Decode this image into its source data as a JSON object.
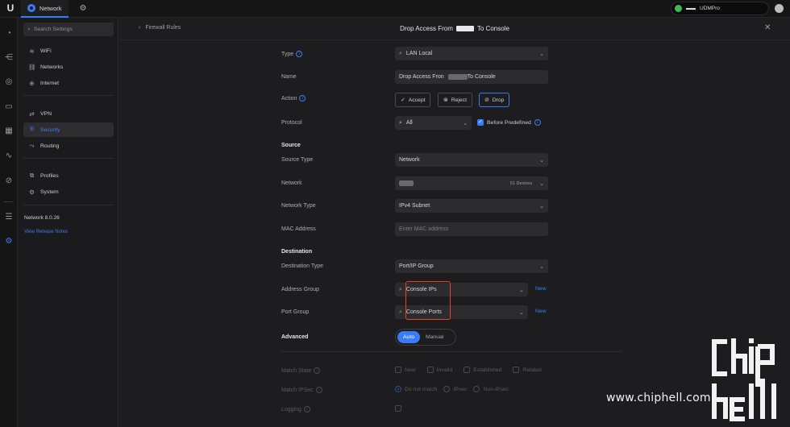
{
  "topbar": {
    "logo": "U",
    "app_tab_label": "Network",
    "device_name": "UDMPro"
  },
  "sidebar": {
    "search_placeholder": "Search Settings",
    "items": [
      {
        "label": "WiFi",
        "icon": "wifi-icon"
      },
      {
        "label": "Networks",
        "icon": "networks-icon"
      },
      {
        "label": "Internet",
        "icon": "globe-icon"
      },
      {
        "label": "VPN",
        "icon": "vpn-icon"
      },
      {
        "label": "Security",
        "icon": "shield-icon",
        "active": true
      },
      {
        "label": "Routing",
        "icon": "routing-icon"
      },
      {
        "label": "Profiles",
        "icon": "profiles-icon"
      },
      {
        "label": "System",
        "icon": "gear-icon"
      }
    ],
    "version": "Network 8.0.26",
    "release_notes_link": "View Release Notes"
  },
  "header": {
    "back_label": "Firewall Rules",
    "title_prefix": "Drop Access From",
    "title_suffix": "To Console"
  },
  "form": {
    "type": {
      "label": "Type",
      "value": "LAN Local"
    },
    "name": {
      "label": "Name",
      "value_prefix": "Drop Access Fron",
      "value_suffix": "To Console"
    },
    "action": {
      "label": "Action",
      "options": [
        "Accept",
        "Reject",
        "Drop"
      ],
      "selected": "Drop"
    },
    "protocol": {
      "label": "Protocol",
      "value": "All",
      "before_predefined_label": "Before Predefined",
      "before_predefined_checked": true
    },
    "source": {
      "section_label": "Source",
      "source_type": {
        "label": "Source Type",
        "value": "Network"
      },
      "network": {
        "label": "Network",
        "device_count": "51 Devices"
      },
      "network_type": {
        "label": "Network Type",
        "value": "IPv4 Subnet"
      },
      "mac_address": {
        "label": "MAC Address",
        "placeholder": "Enter MAC address"
      }
    },
    "destination": {
      "section_label": "Destination",
      "destination_type": {
        "label": "Destination Type",
        "value": "Port/IP Group"
      },
      "address_group": {
        "label": "Address Group",
        "value": "Console IPs",
        "new_label": "New"
      },
      "port_group": {
        "label": "Port Group",
        "value": "Console Ports",
        "new_label": "New"
      }
    },
    "advanced": {
      "section_label": "Advanced",
      "options": [
        "Auto",
        "Manual"
      ],
      "selected": "Auto",
      "match_state": {
        "label": "Match State",
        "options": [
          "New",
          "Invalid",
          "Established",
          "Related"
        ]
      },
      "match_ipsec": {
        "label": "Match IPSec",
        "options": [
          "Do not match",
          "IPsec",
          "Non-IPsec"
        ],
        "selected": "Do not match"
      },
      "logging": {
        "label": "Logging"
      }
    }
  },
  "watermark": {
    "url_text": "www.chiphell.com",
    "logo_text": "chip hell"
  },
  "colors": {
    "accent": "#3a7cf7",
    "highlight": "#e0442e",
    "background": "#1d1d1f"
  }
}
